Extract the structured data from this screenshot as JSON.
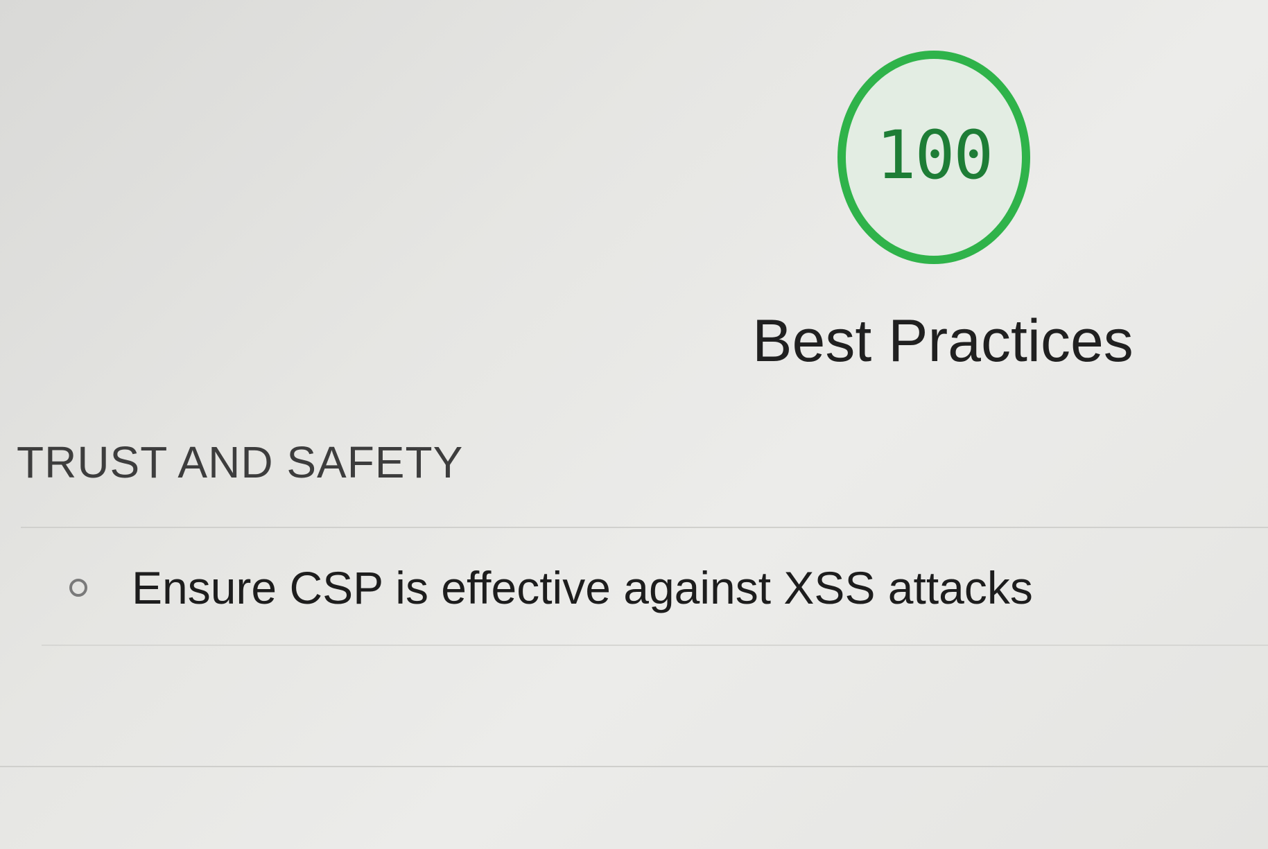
{
  "score": {
    "value": "100",
    "fraction": 1.0,
    "color": "#2fb34a"
  },
  "category": {
    "title": "Best Practices"
  },
  "groups": [
    {
      "heading": "TRUST AND SAFETY",
      "audits": [
        {
          "status_icon": "informative-circle-icon",
          "label": "Ensure CSP is effective against XSS attacks"
        }
      ]
    }
  ]
}
